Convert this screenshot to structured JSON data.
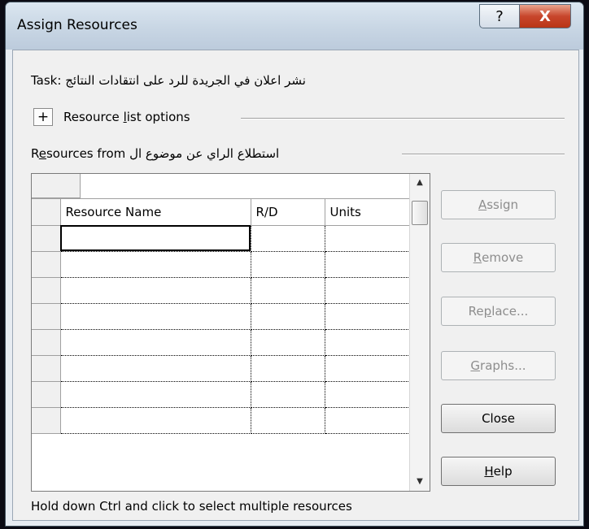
{
  "window": {
    "title": "Assign Resources",
    "help_glyph": "?",
    "close_glyph": "X"
  },
  "task": {
    "label": "Task:",
    "name": "نشر اعلان في الجريدة للرد على انتقادات النتائج"
  },
  "resource_list_options": {
    "toggle": "+",
    "label_pre": "Resource ",
    "label_mn": "l",
    "label_post": "ist options"
  },
  "resources_from": {
    "label_pre": "R",
    "label_mn": "e",
    "label_post": "sources from",
    "source": "استطلاع الراي عن موضوع ال"
  },
  "grid": {
    "columns": [
      "Resource Name",
      "R/D",
      "Units"
    ],
    "row_count": 8,
    "scroll_up_icon": "▲",
    "scroll_down_icon": "▼"
  },
  "buttons": {
    "assign": {
      "pre": "",
      "mn": "A",
      "post": "ssign",
      "enabled": false
    },
    "remove": {
      "pre": "",
      "mn": "R",
      "post": "emove",
      "enabled": false
    },
    "replace": {
      "pre": "Re",
      "mn": "p",
      "post": "lace...",
      "enabled": false
    },
    "graphs": {
      "pre": "",
      "mn": "G",
      "post": "raphs...",
      "enabled": false
    },
    "close": {
      "pre": "Close",
      "mn": "",
      "post": "",
      "enabled": true
    },
    "help": {
      "pre": "",
      "mn": "H",
      "post": "elp",
      "enabled": true
    }
  },
  "status": "Hold down Ctrl and click to select multiple resources",
  "icons": {
    "help": "question-icon",
    "close": "close-icon",
    "expand": "plus-icon"
  }
}
